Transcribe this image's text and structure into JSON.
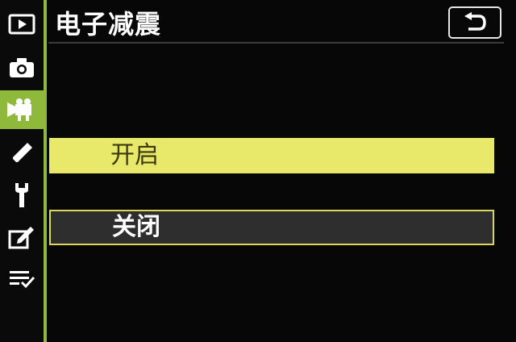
{
  "header": {
    "title": "电子减震"
  },
  "tabs": [
    {
      "icon": "playback-icon"
    },
    {
      "icon": "camera-icon"
    },
    {
      "icon": "movie-camera-icon",
      "active": true
    },
    {
      "icon": "pencil-icon"
    },
    {
      "icon": "wrench-icon"
    },
    {
      "icon": "retouch-icon"
    },
    {
      "icon": "my-menu-icon"
    }
  ],
  "options": {
    "on_label": "开启",
    "off_label": "关闭",
    "selected": "关闭"
  },
  "colors": {
    "accent_green": "#8fb93a",
    "highlight_yellow": "#e8e86a",
    "selection_border": "#d8d85a",
    "background": "#070707"
  }
}
